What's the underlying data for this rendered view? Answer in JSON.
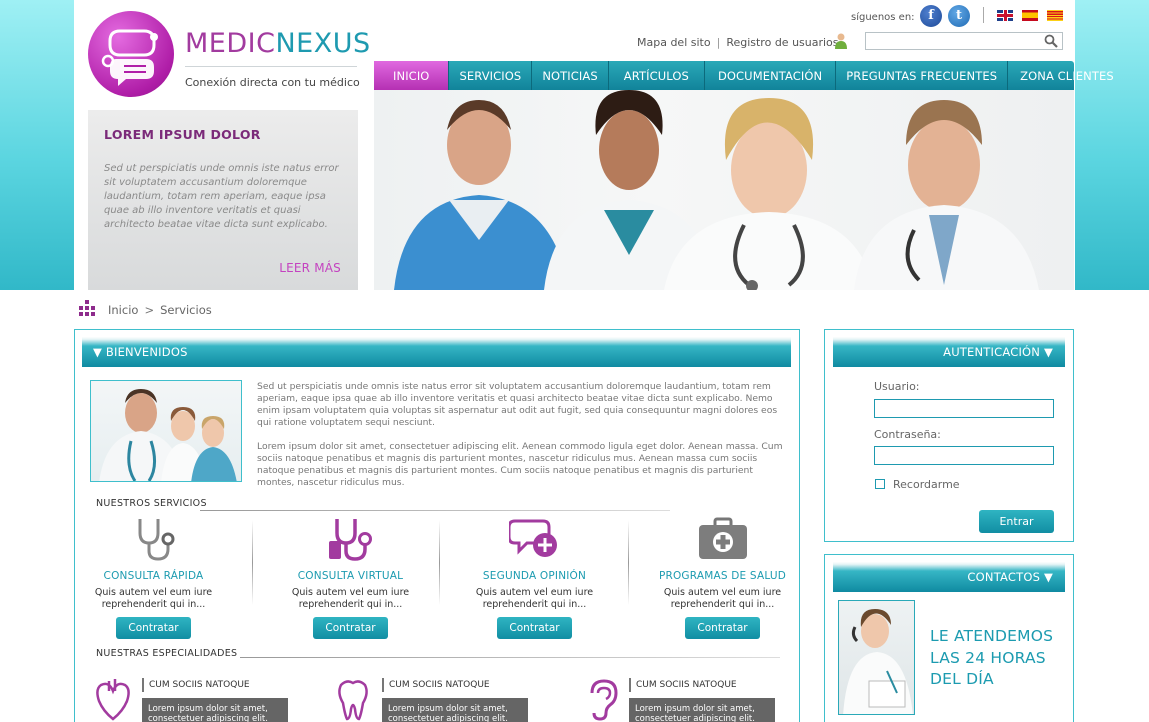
{
  "brand": {
    "name_part1": "MEDIC",
    "name_part2": "NEXUS",
    "tagline": "Conexión directa con tu médico"
  },
  "social": {
    "label": "síguenos en:",
    "facebook_glyph": "f",
    "twitter_glyph": "t"
  },
  "top_links": {
    "site_map": "Mapa del sito",
    "separator": "|",
    "register": "Registro de usuarios"
  },
  "search": {
    "placeholder": ""
  },
  "nav": {
    "items": [
      "INICIO",
      "SERVICIOS",
      "NOTICIAS",
      "ARTÍCULOS",
      "DOCUMENTACIÓN",
      "PREGUNTAS FRECUENTES",
      "ZONA CLIENTES"
    ],
    "active_index": 0
  },
  "promo": {
    "title": "LOREM IPSUM DOLOR",
    "text": "Sed ut perspiciatis unde omnis iste natus error sit voluptatem accusantium doloremque laudantium, totam rem aperiam, eaque ipsa quae ab illo inventore veritatis et quasi architecto beatae vitae dicta sunt explicabo.",
    "more": "LEER MÁS"
  },
  "breadcrumb": {
    "home": "Inicio",
    "sep": ">",
    "current": "Servicios"
  },
  "welcome": {
    "title": "▼  BIENVENIDOS",
    "p1": "Sed ut perspiciatis unde omnis iste natus error sit voluptatem accusantium doloremque laudantium, totam rem aperiam, eaque ipsa quae ab illo inventore veritatis et quasi architecto beatae vitae dicta sunt explicabo. Nemo enim ipsam voluptatem quia voluptas sit aspernatur aut odit aut fugit, sed quia consequuntur magni dolores eos qui ratione voluptatem sequi nesciunt.",
    "p2": "Lorem ipsum dolor sit amet, consectetuer adipiscing elit. Aenean commodo ligula eget dolor. Aenean massa. Cum sociis natoque penatibus et magnis dis parturient montes, nascetur ridiculus mus. Aenean massa cum sociis natoque penatibus et magnis dis parturient montes. Cum sociis natoque penatibus et magnis dis parturient montes, nascetur ridiculus mus."
  },
  "services": {
    "title": "NUESTROS SERVICIOS",
    "items": [
      {
        "name": "CONSULTA RÁPIDA",
        "desc1": "Quis autem vel eum iure",
        "desc2": "reprehenderit qui in...",
        "button": "Contratar",
        "icon": "stethoscope-grey-icon"
      },
      {
        "name": "CONSULTA VIRTUAL",
        "desc1": "Quis autem vel eum iure",
        "desc2": "reprehenderit qui in...",
        "button": "Contratar",
        "icon": "stethoscope-purple-icon"
      },
      {
        "name": "SEGUNDA OPINIÓN",
        "desc1": "Quis autem vel eum iure",
        "desc2": "reprehenderit qui in...",
        "button": "Contratar",
        "icon": "speech-bubble-plus-icon"
      },
      {
        "name": "PROGRAMAS DE SALUD",
        "desc1": "Quis autem vel eum iure",
        "desc2": "reprehenderit qui in...",
        "button": "Contratar",
        "icon": "first-aid-kit-icon"
      }
    ]
  },
  "specialties": {
    "title": "NUESTRAS ESPECIALIDADES",
    "items": [
      {
        "name": "CUM SOCIIS NATOQUE",
        "text1": "Lorem ipsum dolor sit amet,",
        "text2": "consectetuer adipiscing elit.",
        "icon": "heart-icon"
      },
      {
        "name": "CUM SOCIIS NATOQUE",
        "text1": "Lorem ipsum dolor sit amet,",
        "text2": "consectetuer adipiscing elit.",
        "icon": "tooth-icon"
      },
      {
        "name": "CUM SOCIIS NATOQUE",
        "text1": "Lorem ipsum dolor sit amet,",
        "text2": "consectetuer adipiscing elit.",
        "icon": "ear-icon"
      }
    ]
  },
  "auth": {
    "title": "AUTENTICACIÓN  ▼",
    "user_label": "Usuario:",
    "password_label": "Contraseña:",
    "remember": "Recordarme",
    "submit": "Entrar"
  },
  "contacts": {
    "title": "CONTACTOS  ▼",
    "line1": "LE ATENDEMOS",
    "line2": "LAS 24 HORAS",
    "line3": "DEL DÍA"
  },
  "colors": {
    "teal": "#1c9bb0",
    "magenta": "#b530b3",
    "nav_bg": "#11839a"
  }
}
